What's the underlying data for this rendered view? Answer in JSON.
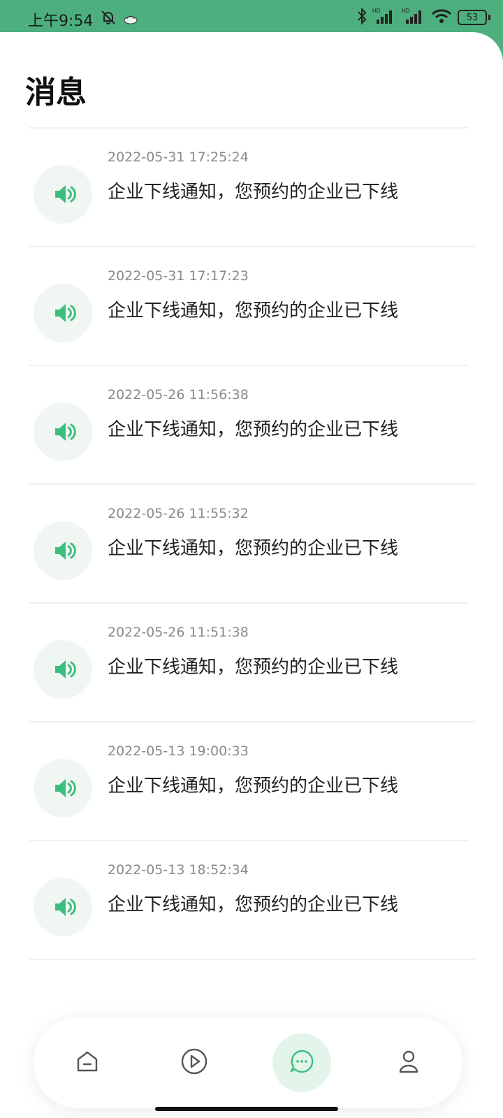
{
  "status_bar": {
    "time": "上午9:54",
    "battery": "53",
    "icons": [
      "mute-icon",
      "app-notification-icon",
      "bluetooth-icon",
      "signal-hd-icon",
      "signal-hd-icon",
      "wifi-icon",
      "battery-icon"
    ]
  },
  "header": {
    "title": "消息"
  },
  "messages": [
    {
      "time": "2022-05-31 17:25:24",
      "text": "企业下线通知，您预约的企业已下线",
      "icon": "speaker-icon"
    },
    {
      "time": "2022-05-31 17:17:23",
      "text": "企业下线通知，您预约的企业已下线",
      "icon": "speaker-icon"
    },
    {
      "time": "2022-05-26 11:56:38",
      "text": "企业下线通知，您预约的企业已下线",
      "icon": "speaker-icon"
    },
    {
      "time": "2022-05-26 11:55:32",
      "text": "企业下线通知，您预约的企业已下线",
      "icon": "speaker-icon"
    },
    {
      "time": "2022-05-26 11:51:38",
      "text": "企业下线通知，您预约的企业已下线",
      "icon": "speaker-icon"
    },
    {
      "time": "2022-05-13 19:00:33",
      "text": "企业下线通知，您预约的企业已下线",
      "icon": "speaker-icon"
    },
    {
      "time": "2022-05-13 18:52:34",
      "text": "企业下线通知，您预约的企业已下线",
      "icon": "speaker-icon"
    }
  ],
  "tab_bar": {
    "tabs": [
      {
        "name": "home",
        "icon": "home-icon",
        "active": false
      },
      {
        "name": "video",
        "icon": "play-icon",
        "active": false
      },
      {
        "name": "messages",
        "icon": "chat-icon",
        "active": true
      },
      {
        "name": "profile",
        "icon": "user-icon",
        "active": false
      }
    ]
  },
  "colors": {
    "accent": "#4caf7d",
    "icon_green": "#3cbf7e",
    "active_tab_bg": "#e3f4ea",
    "timestamp": "#8a8a8a"
  }
}
